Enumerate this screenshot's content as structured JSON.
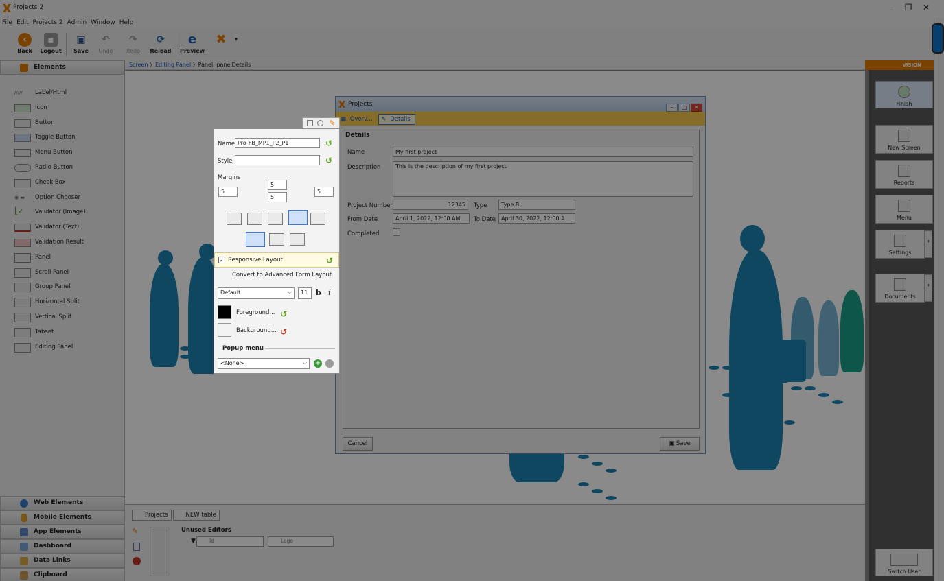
{
  "window": {
    "title": "Projects 2"
  },
  "menu": [
    "File",
    "Edit",
    "Projects 2",
    "Admin",
    "Window",
    "Help"
  ],
  "toolbar": {
    "back": "Back",
    "logout": "Logout",
    "save": "Save",
    "undo": "Undo",
    "redo": "Redo",
    "reload": "Reload",
    "preview": "Preview"
  },
  "left_panel": {
    "elements_header": "Elements",
    "items": [
      "Label/Html",
      "Icon",
      "Button",
      "Toggle Button",
      "Menu Button",
      "Radio Button",
      "Check Box",
      "Option Chooser",
      "Validator (Image)",
      "Validator (Text)",
      "Validation Result",
      "Panel",
      "Scroll Panel",
      "Group Panel",
      "Horizontal Split",
      "Vertical Split",
      "Tabset",
      "Editing Panel"
    ],
    "sections": [
      "Web Elements",
      "Mobile Elements",
      "App Elements",
      "Dashboard",
      "Data Links",
      "Clipboard"
    ]
  },
  "breadcrumb": {
    "screen": "Screen",
    "editing_panel": "Editing Panel",
    "current": "Panel: panelDetails"
  },
  "projects_window": {
    "title": "Projects",
    "tabs": [
      "Overv...",
      "Details"
    ],
    "section": "Details",
    "name_label": "Name",
    "name_value": "My first project",
    "description_label": "Description",
    "description_value": "This is the description of my first project",
    "project_number_label": "Project Number",
    "project_number_value": "12345",
    "type_label": "Type",
    "type_value": "Type B",
    "from_date_label": "From Date",
    "from_date_value": "April 1, 2022, 12:00 AM",
    "to_date_label": "To Date",
    "to_date_value": "April 30, 2022, 12:00 A",
    "completed_label": "Completed",
    "cancel": "Cancel",
    "save": "Save"
  },
  "properties": {
    "name_label": "Name",
    "name_value": "Pro-FB_MP1_P2_P1",
    "style_label": "Style",
    "style_value": "",
    "margins_label": "Margins",
    "margin_top": "5",
    "margin_left": "5",
    "margin_right": "5",
    "margin_bottom": "5",
    "responsive_layout": "Responsive Layout",
    "convert_link": "Convert to Advanced Form Layout",
    "font_value": "Default",
    "font_size": "11",
    "bold": "b",
    "italic": "i",
    "foreground": "Foreground...",
    "background": "Background...",
    "popup_menu_label": "Popup menu",
    "popup_menu_value": "<None>"
  },
  "right_panel": {
    "vision_label": "VISION",
    "finish": "Finish",
    "new_screen": "New Screen",
    "reports": "Reports",
    "menu": "Menu",
    "settings": "Settings",
    "documents": "Documents",
    "switch_user": "Switch User"
  },
  "bottom": {
    "tabs": [
      "Projects",
      "NEW table"
    ],
    "unused_editors": "Unused Editors",
    "fields": [
      "Id",
      "Logo"
    ]
  },
  "colors": {
    "accent": "#e07b00",
    "tab_yellow": "#f6c84c",
    "link_blue": "#1a55c8",
    "figure_blue": "#1c83b4"
  }
}
